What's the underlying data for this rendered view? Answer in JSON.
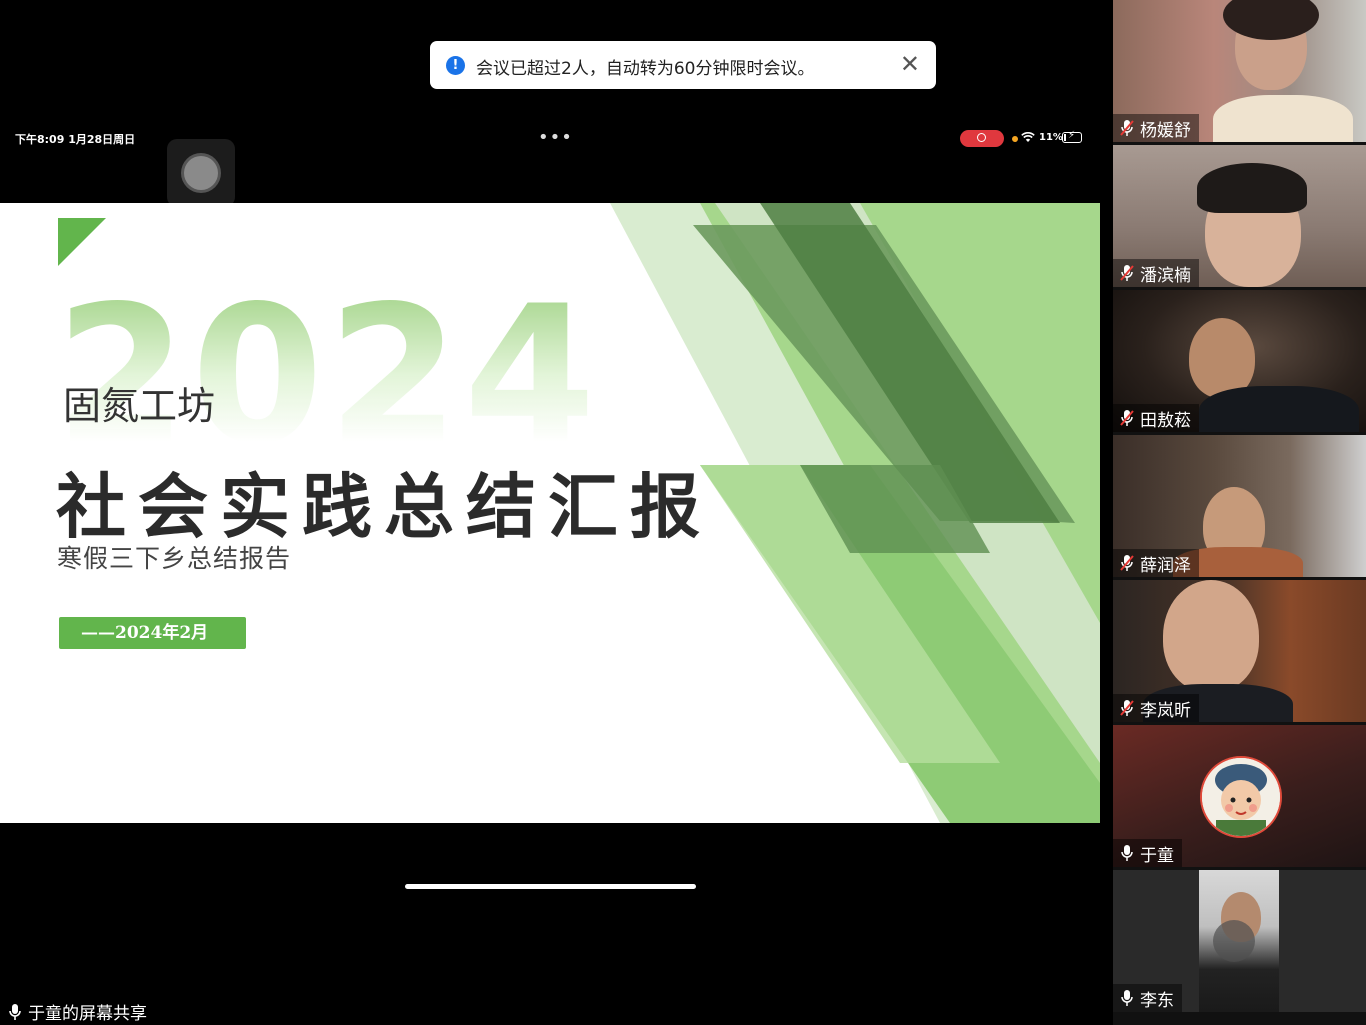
{
  "toast": {
    "message": "会议已超过2人，自动转为60分钟限时会议。",
    "info_icon": "info-icon",
    "close_icon": "close-icon"
  },
  "status_bar": {
    "time": "下午8:09   1月28日周日",
    "battery": "11%"
  },
  "slide": {
    "year": "2024",
    "org": "固氮工坊",
    "title": "社会实践总结汇报",
    "subtitle": "寒假三下乡总结报告",
    "date": "——2024年2月",
    "colors": {
      "accent": "#62b54c",
      "dark_green": "#4f7f43",
      "light_green": "#a6d78c"
    }
  },
  "share_label": "于童的屏幕共享",
  "participants": [
    {
      "name": "杨媛舒",
      "muted": true
    },
    {
      "name": "潘滨楠",
      "muted": true
    },
    {
      "name": "田敖菘",
      "muted": true
    },
    {
      "name": "薛润泽",
      "muted": true
    },
    {
      "name": "李岚昕",
      "muted": true
    },
    {
      "name": "于童",
      "muted": false
    },
    {
      "name": "李东",
      "muted": false
    }
  ]
}
